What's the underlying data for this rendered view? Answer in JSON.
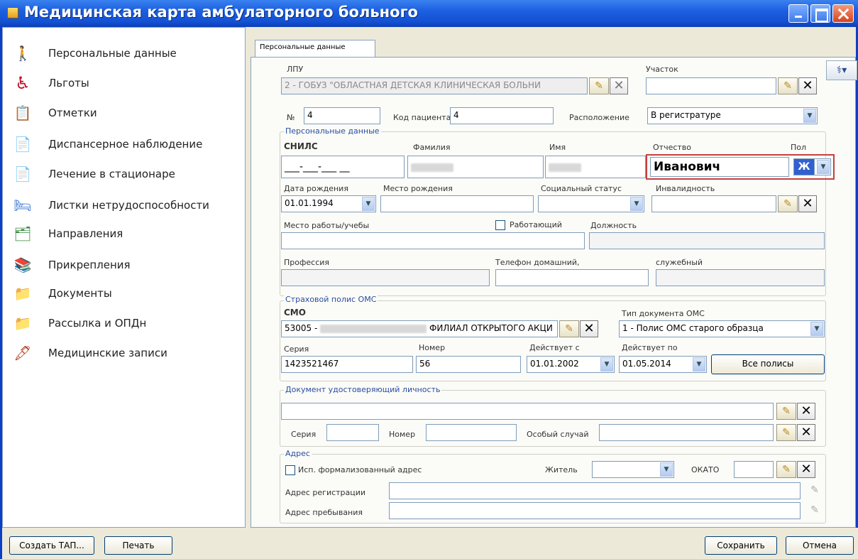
{
  "window": {
    "title": "Медицинская карта амбулаторного больного",
    "minimize": "minimize-button",
    "maximize": "maximize-button",
    "close": "close-button"
  },
  "sidebar": {
    "items": [
      {
        "label": "Персональные данные",
        "icon": "person-walking-icon"
      },
      {
        "label": "Льготы",
        "icon": "wheelchair-icon"
      },
      {
        "label": "Отметки",
        "icon": "notes-icon"
      },
      {
        "label": "Диспансерное наблюдение",
        "icon": "document-list-icon"
      },
      {
        "label": "Лечение в стационаре",
        "icon": "document-icon"
      },
      {
        "label": "Листки нетрудоспособности",
        "icon": "sick-leave-icon"
      },
      {
        "label": "Направления",
        "icon": "referral-icon"
      },
      {
        "label": "Прикрепления",
        "icon": "books-icon"
      },
      {
        "label": "Документы",
        "icon": "folder-docs-icon"
      },
      {
        "label": "Рассылка и ОПДн",
        "icon": "folder-docs-icon"
      },
      {
        "label": "Медицинские записи",
        "icon": "pen-records-icon"
      }
    ]
  },
  "tab": {
    "label": "Персональные данные"
  },
  "lpu": {
    "label": "ЛПУ",
    "value": "2 - ГОБУЗ \"ОБЛАСТНАЯ ДЕТСКАЯ КЛИНИЧЕСКАЯ БОЛЬНИ"
  },
  "uchastok": {
    "label": "Участок",
    "value": ""
  },
  "number": {
    "label": "№",
    "value": "4"
  },
  "patient_code": {
    "label": "Код пациента",
    "value": "4"
  },
  "location": {
    "label": "Расположение",
    "value": "В регистратуре"
  },
  "personal": {
    "group_title": "Персональные данные",
    "snils_label": "СНИЛС",
    "snils_value": "___-___-___ __",
    "surname_label": "Фамилия",
    "name_label": "Имя",
    "patronymic_label": "Отчество",
    "patronymic_value": "Иванович",
    "gender_label": "Пол",
    "gender_value": "Ж",
    "birthdate_label": "Дата рождения",
    "birthdate_value": "01.01.1994",
    "birthplace_label": "Место рождения",
    "social_label": "Социальный статус",
    "disability_label": "Инвалидность",
    "work_label": "Место работы/учебы",
    "working_label": "Работающий",
    "position_label": "Должность",
    "profession_label": "Профессия",
    "phone_home_label": "Телефон домашний,",
    "phone_work_label": "служебный"
  },
  "oms": {
    "group_title": "Страховой полис ОМС",
    "smo_label": "СМО",
    "smo_value_prefix": "53005 -",
    "smo_value_suffix": "ФИЛИАЛ ОТКРЫТОГО АКЦИ",
    "doc_type_label": "Тип документа ОМС",
    "doc_type_value": "1 - Полис ОМС старого образца",
    "series_label": "Серия",
    "series_value": "1423521467",
    "number_label": "Номер",
    "number_value": "56",
    "valid_from_label": "Действует с",
    "valid_from_value": "01.01.2002",
    "valid_to_label": "Действует по",
    "valid_to_value": "01.05.2014",
    "all_policies": "Все полисы"
  },
  "identity": {
    "group_title": "Документ удостоверяющий личность",
    "series_label": "Серия",
    "number_label": "Номер",
    "special_label": "Особый случай"
  },
  "address": {
    "group_title": "Адрес",
    "formalized_label": "Исп. формализованный адрес",
    "resident_label": "Житель",
    "okato_label": "ОКАТО",
    "reg_label": "Адрес регистрации",
    "stay_label": "Адрес пребывания"
  },
  "footer": {
    "create_tap": "Создать ТАП...",
    "print": "Печать",
    "save": "Сохранить",
    "cancel": "Отмена"
  }
}
